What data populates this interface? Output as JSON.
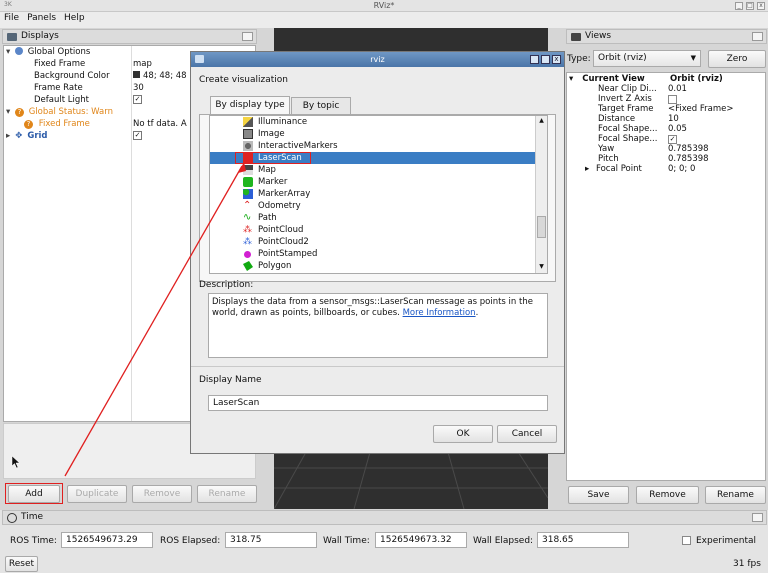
{
  "window": {
    "title": "RViz*",
    "corner": "3K"
  },
  "menu": [
    "File",
    "Panels",
    "Help"
  ],
  "displays": {
    "header": "Displays",
    "rows": [
      {
        "label": "Global Options",
        "value": ""
      },
      {
        "label": "Fixed Frame",
        "value": "map"
      },
      {
        "label": "Background Color",
        "value": "48; 48; 48"
      },
      {
        "label": "Frame Rate",
        "value": "30"
      },
      {
        "label": "Default Light",
        "value": ""
      },
      {
        "label": "Global Status: Warn",
        "value": ""
      },
      {
        "label": "Fixed Frame",
        "value": "No tf data.  A"
      },
      {
        "label": "Grid",
        "value": ""
      }
    ],
    "buttons": {
      "add": "Add",
      "duplicate": "Duplicate",
      "remove": "Remove",
      "rename": "Rename"
    }
  },
  "dialog": {
    "title": "rviz",
    "heading": "Create visualization",
    "tabs": [
      "By display type",
      "By topic"
    ],
    "items": [
      "Illuminance",
      "Image",
      "InteractiveMarkers",
      "LaserScan",
      "Map",
      "Marker",
      "MarkerArray",
      "Odometry",
      "Path",
      "PointCloud",
      "PointCloud2",
      "PointStamped",
      "Polygon"
    ],
    "selected": "LaserScan",
    "description_label": "Description:",
    "description": "Displays the data from a sensor_msgs::LaserScan message as points in the world, drawn as points, billboards, or cubes.",
    "more_info": "More Information",
    "name_label": "Display Name",
    "name_value": "LaserScan",
    "ok": "OK",
    "cancel": "Cancel"
  },
  "views": {
    "header": "Views",
    "type_label": "Type:",
    "type_value": "Orbit (rviz)",
    "zero": "Zero",
    "rows": [
      {
        "label": "Current View",
        "value": "Orbit (rviz)"
      },
      {
        "label": "Near Clip Di...",
        "value": "0.01"
      },
      {
        "label": "Invert Z Axis",
        "value": ""
      },
      {
        "label": "Target Frame",
        "value": "<Fixed Frame>"
      },
      {
        "label": "Distance",
        "value": "10"
      },
      {
        "label": "Focal Shape...",
        "value": "0.05"
      },
      {
        "label": "Focal Shape...",
        "value": ""
      },
      {
        "label": "Yaw",
        "value": "0.785398"
      },
      {
        "label": "Pitch",
        "value": "0.785398"
      },
      {
        "label": "Focal Point",
        "value": "0; 0; 0"
      }
    ],
    "buttons": {
      "save": "Save",
      "remove": "Remove",
      "rename": "Rename"
    }
  },
  "time": {
    "header": "Time",
    "ros_time_label": "ROS Time:",
    "ros_time": "1526549673.29",
    "ros_elapsed_label": "ROS Elapsed:",
    "ros_elapsed": "318.75",
    "wall_time_label": "Wall Time:",
    "wall_time": "1526549673.32",
    "wall_elapsed_label": "Wall Elapsed:",
    "wall_elapsed": "318.65",
    "experimental": "Experimental",
    "reset": "Reset",
    "fps": "31 fps"
  },
  "colors": {
    "accent": "#3a7dc4",
    "warn": "#e0861a",
    "annotation": "#e02020"
  }
}
